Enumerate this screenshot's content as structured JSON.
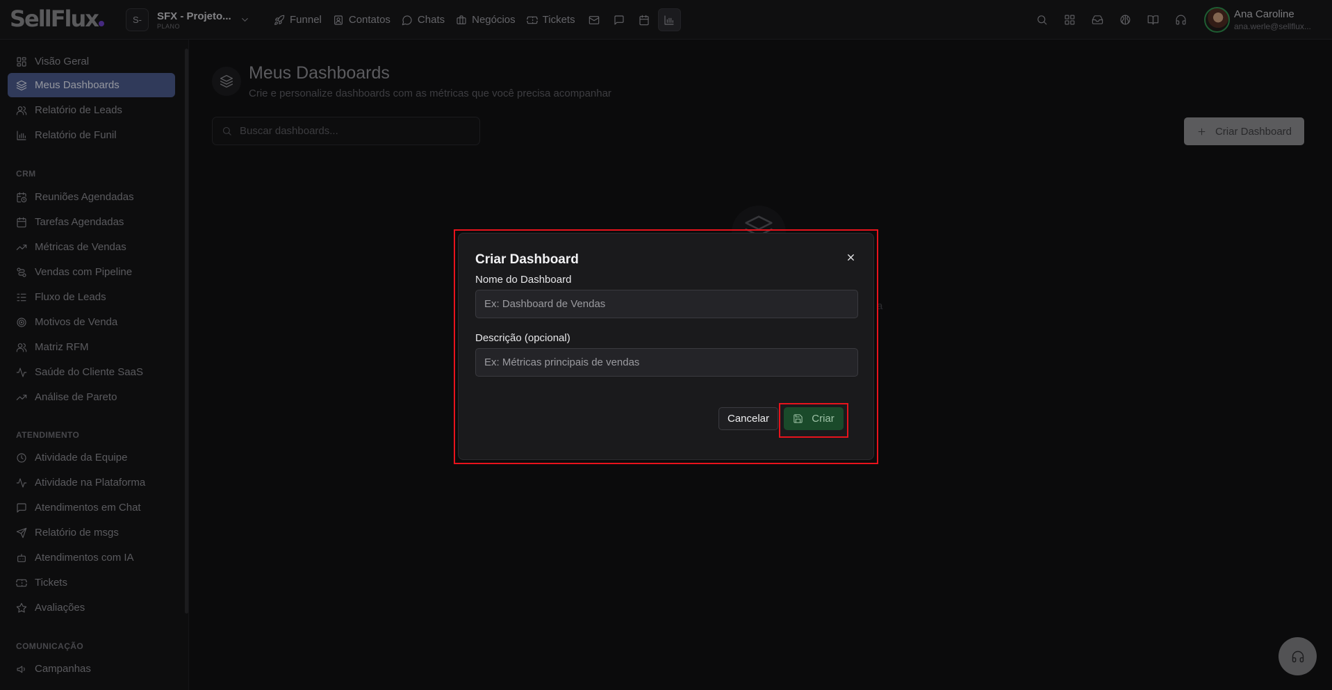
{
  "topbar": {
    "logo": "SellFlux",
    "project": {
      "badge": "S-",
      "name": "SFX - Projeto...",
      "plan": "PLANO"
    },
    "nav": [
      {
        "label": "Funnel",
        "icon": "rocket-icon"
      },
      {
        "label": "Contatos",
        "icon": "contacts-icon"
      },
      {
        "label": "Chats",
        "icon": "chat-icon"
      },
      {
        "label": "Negócios",
        "icon": "briefcase-icon"
      },
      {
        "label": "Tickets",
        "icon": "ticket-icon"
      }
    ],
    "nav_icons": [
      "mail-icon",
      "message-icon",
      "calendar-icon",
      "bar-chart-icon"
    ],
    "right_icons": [
      "search-icon",
      "apps-grid-icon",
      "inbox-icon",
      "globe-icon",
      "book-icon",
      "headset-icon"
    ],
    "user": {
      "name": "Ana Caroline",
      "email": "ana.werle@sellflux..."
    }
  },
  "sidebar": {
    "top_items": [
      {
        "label": "Visão Geral",
        "icon": "grid-icon"
      },
      {
        "label": "Meus Dashboards",
        "icon": "layers-icon",
        "active": true
      },
      {
        "label": "Relatório de Leads",
        "icon": "users-icon"
      },
      {
        "label": "Relatório de Funil",
        "icon": "bar-chart-icon"
      }
    ],
    "sections": [
      {
        "heading": "CRM",
        "items": [
          {
            "label": "Reuniões Agendadas",
            "icon": "calendar-clock-icon"
          },
          {
            "label": "Tarefas Agendadas",
            "icon": "calendar-icon"
          },
          {
            "label": "Métricas de Vendas",
            "icon": "trending-up-icon"
          },
          {
            "label": "Vendas com Pipeline",
            "icon": "pipeline-icon"
          },
          {
            "label": "Fluxo de Leads",
            "icon": "list-flow-icon"
          },
          {
            "label": "Motivos de Venda",
            "icon": "target-icon"
          },
          {
            "label": "Matriz RFM",
            "icon": "users-icon"
          },
          {
            "label": "Saúde do Cliente SaaS",
            "icon": "activity-icon"
          },
          {
            "label": "Análise de Pareto",
            "icon": "trending-up-icon"
          }
        ]
      },
      {
        "heading": "ATENDIMENTO",
        "items": [
          {
            "label": "Atividade da Equipe",
            "icon": "clock-icon"
          },
          {
            "label": "Atividade na Plataforma",
            "icon": "activity-icon"
          },
          {
            "label": "Atendimentos em Chat",
            "icon": "message-square-icon"
          },
          {
            "label": "Relatório de msgs",
            "icon": "send-icon"
          },
          {
            "label": "Atendimentos com IA",
            "icon": "bot-icon"
          },
          {
            "label": "Tickets",
            "icon": "ticket-icon"
          },
          {
            "label": "Avaliações",
            "icon": "star-icon"
          }
        ]
      },
      {
        "heading": "COMUNICAÇÃO",
        "items": [
          {
            "label": "Campanhas",
            "icon": "megaphone-icon"
          }
        ]
      }
    ]
  },
  "main": {
    "title": "Meus Dashboards",
    "subtitle": "Crie e personalize dashboards com as métricas que você precisa acompanhar",
    "search_placeholder": "Buscar dashboards...",
    "create_button": "Criar Dashboard",
    "peek_text": "a"
  },
  "modal": {
    "title": "Criar Dashboard",
    "name_label": "Nome do Dashboard",
    "name_placeholder": "Ex: Dashboard de Vendas",
    "name_value": "",
    "desc_label": "Descrição (opcional)",
    "desc_placeholder": "Ex: Métricas principais de vendas",
    "desc_value": "",
    "cancel_label": "Cancelar",
    "submit_label": "Criar"
  },
  "colors": {
    "accent_active": "#4a5a8a",
    "submit_green": "#1a4a2a",
    "highlight_red": "#e8131c"
  }
}
